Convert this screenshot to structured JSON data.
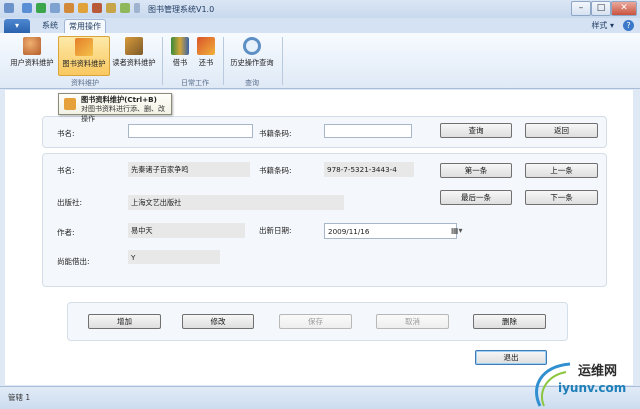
{
  "window": {
    "title": "图书管理系统V1.0",
    "minimize_label": "–",
    "maximize_label": "□",
    "close_label": "✕"
  },
  "ribbon": {
    "tabs": [
      {
        "label": "系统"
      },
      {
        "label": "常用操作",
        "active": true
      }
    ],
    "styles_menu": "样式 ▾",
    "help_label": "?",
    "groups": [
      {
        "label": "资料维护",
        "buttons": [
          {
            "label": "用户资料维护",
            "icon": "users-icon"
          },
          {
            "label": "图书资料维护",
            "icon": "books-icon",
            "selected": true
          },
          {
            "label": "读者资料维护",
            "icon": "reader-icon"
          }
        ]
      },
      {
        "label": "日常工作",
        "buttons": [
          {
            "label": "借书",
            "icon": "borrow-book-icon"
          },
          {
            "label": "还书",
            "icon": "return-book-icon"
          }
        ]
      },
      {
        "label": "查询",
        "buttons": [
          {
            "label": "历史操作查询",
            "icon": "magnifier-icon"
          }
        ]
      }
    ]
  },
  "tooltip": {
    "title": "图书资料维护(Ctrl+B)",
    "description": "对图书资料进行添、删、改操作"
  },
  "search": {
    "name_label": "书名:",
    "name_value": "",
    "barcode_label": "书籍条码:",
    "barcode_value": "",
    "query_button": "查询",
    "back_button": "返回"
  },
  "detail": {
    "name_label": "书名:",
    "name_value": "先秦诸子百家争鸣",
    "barcode_label": "书籍条码:",
    "barcode_value": "978-7-5321-3443-4",
    "publisher_label": "出版社:",
    "publisher_value": "上海文艺出版社",
    "author_label": "作者:",
    "author_value": "易中天",
    "date_label": "出新日期:",
    "date_value": "2009/11/16",
    "lendable_label": "尚能借出:",
    "lendable_value": "Y",
    "first_button": "第一条",
    "prev_button": "上一条",
    "last_button": "最后一条",
    "next_button": "下一条"
  },
  "actions": {
    "add": "增加",
    "edit": "修改",
    "save": "保存",
    "cancel": "取消",
    "delete": "删除",
    "exit": "退出"
  },
  "status_bar": {
    "text": "管辖 1"
  },
  "watermark": {
    "cn": "运维网",
    "en": "iyunv.com"
  },
  "colors": {
    "ribbon_selected": "#f9c860",
    "accent": "#2a62ad"
  }
}
